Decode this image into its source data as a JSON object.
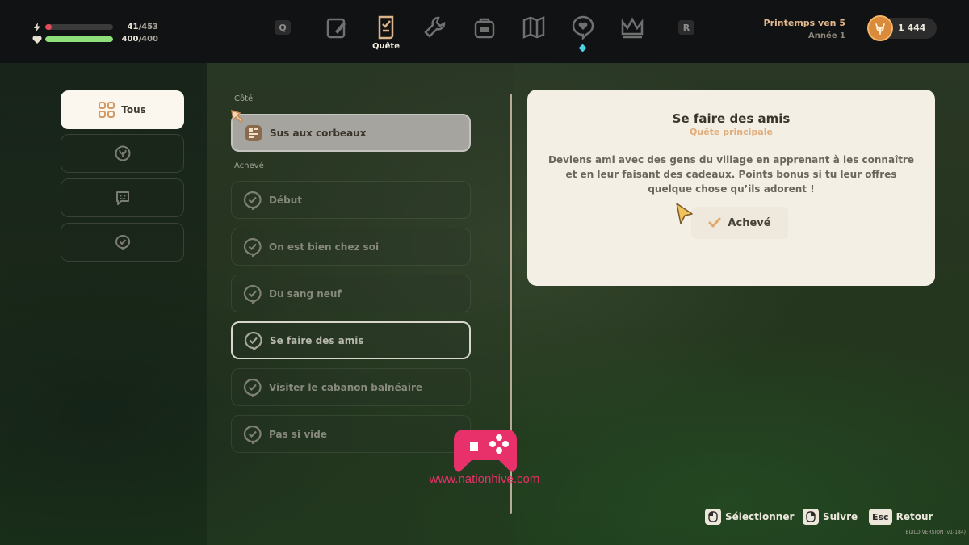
{
  "hud": {
    "energy": {
      "icon": "lightning-icon",
      "value": "41",
      "max": "453",
      "fill_fraction": 0.09,
      "color": "#e24b5a"
    },
    "health": {
      "icon": "heart-icon",
      "value": "400",
      "max": "400",
      "fill_fraction": 1.0,
      "color": "#8fe07a"
    }
  },
  "nav": {
    "left_key": "Q",
    "right_key": "R",
    "tabs": [
      {
        "icon": "journal-icon"
      },
      {
        "icon": "quest-scroll-icon",
        "label": "Quête",
        "active": true
      },
      {
        "icon": "wrench-icon"
      },
      {
        "icon": "backpack-icon"
      },
      {
        "icon": "map-icon"
      },
      {
        "icon": "heart-bubble-icon",
        "notification": true
      },
      {
        "icon": "crown-icon"
      }
    ]
  },
  "calendar": {
    "line1": "Printemps ven 5",
    "line2": "Année 1"
  },
  "money": {
    "icon": "coin-icon",
    "value": "1 444"
  },
  "filters": [
    {
      "icon": "grid-icon",
      "label": "Tous",
      "active": true
    },
    {
      "icon": "leaf-icon",
      "label": ""
    },
    {
      "icon": "chat-face-icon",
      "label": ""
    },
    {
      "icon": "check-bubble-icon",
      "label": ""
    }
  ],
  "quests": {
    "side_header": "Côté",
    "side": [
      {
        "label": "Sus aux corbeaux",
        "icon": "quest-board-icon",
        "tracked": true
      }
    ],
    "done_header": "Achevé",
    "done": [
      {
        "label": "Début"
      },
      {
        "label": "On est bien chez soi"
      },
      {
        "label": "Du sang neuf"
      },
      {
        "label": "Se faire des amis",
        "selected": true
      },
      {
        "label": "Visiter le cabanon balnéaire"
      },
      {
        "label": "Pas si vide"
      }
    ]
  },
  "detail": {
    "title": "Se faire des amis",
    "subtitle": "Quête principale",
    "description": "Deviens ami avec des gens du village en apprenant à les connaître et en leur faisant des cadeaux. Points bonus si tu leur offres quelque chose qu’ils adorent !",
    "status_label": "Achevé"
  },
  "hints": [
    {
      "key": "",
      "key_icon": "mouse-left-icon",
      "label": "Sélectionner"
    },
    {
      "key": "",
      "key_icon": "mouse-right-icon",
      "label": "Suivre"
    },
    {
      "key": "Esc",
      "label": "Retour"
    }
  ],
  "build_version": "BUILD VERSION  (v1-184)",
  "watermark": {
    "text": "www.nationhive.com",
    "icon": "gamepad-logo-icon",
    "color": "#e8306a"
  }
}
